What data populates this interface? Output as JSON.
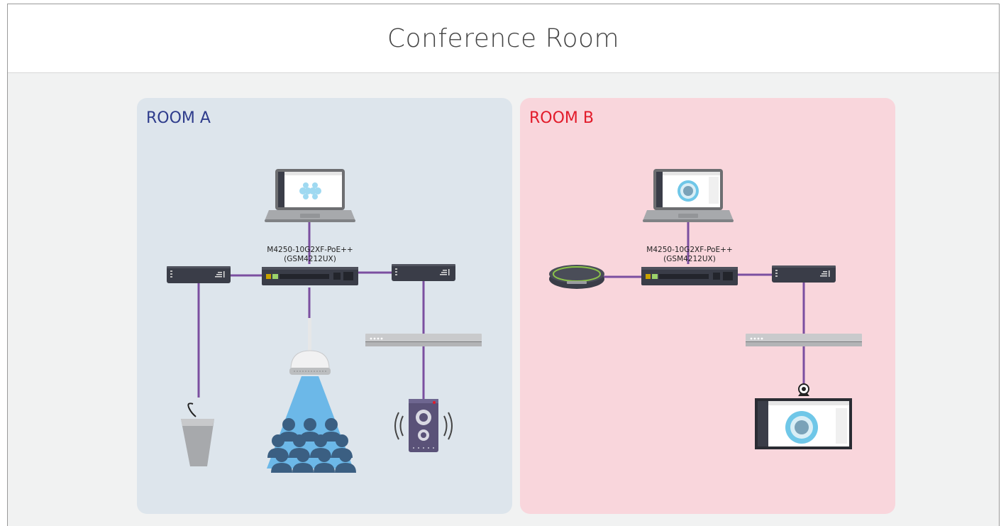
{
  "header": {
    "title": "Conference Room"
  },
  "rooms": [
    {
      "title": "ROOM A",
      "title_color": "#2e3c8c",
      "background": "#dde5ec",
      "switch": {
        "model": "M4250-10G2XF-PoE++",
        "sku": "(GSM4212UX)"
      },
      "devices": [
        "laptop-icon",
        "poe-injector-icon",
        "podium-microphone-icon",
        "ceiling-microphone-icon",
        "audience-icon",
        "amplifier-icon",
        "loudspeaker-icon"
      ]
    },
    {
      "title": "ROOM B",
      "title_color": "#e21b2a",
      "background": "#f9d6dc",
      "switch": {
        "model": "M4250-10G2XF-PoE++",
        "sku": "(GSM4212UX)"
      },
      "devices": [
        "laptop-icon",
        "speakerphone-icon",
        "poe-injector-icon",
        "amplifier-icon",
        "webcam-icon",
        "display-icon"
      ]
    }
  ],
  "colors": {
    "link": "#7b4fa0",
    "device_dark": "#3a3d48",
    "device_light": "#c9cacc"
  }
}
